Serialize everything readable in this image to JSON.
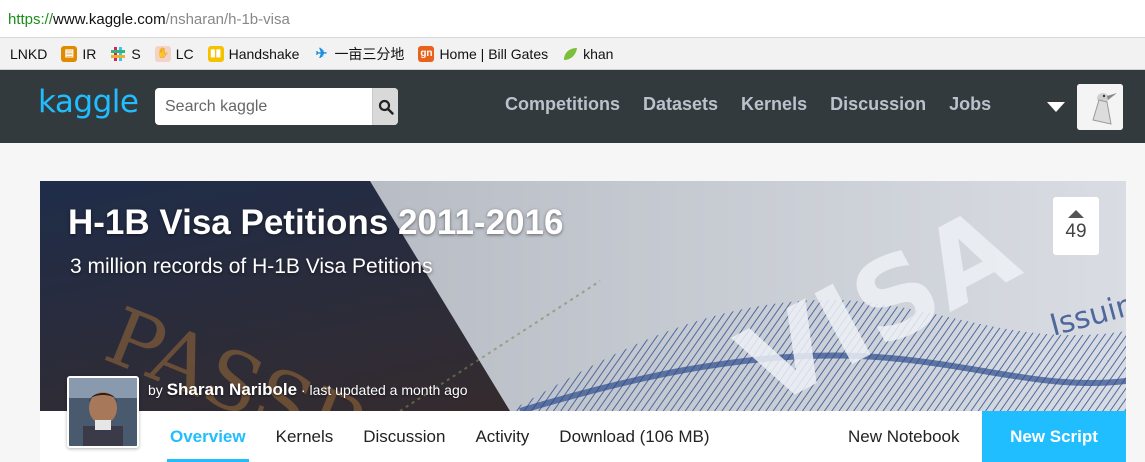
{
  "browser": {
    "url_scheme": "https://",
    "url_host": "www.kaggle.com",
    "url_path": "/nsharan/h-1b-visa",
    "bookmarks": [
      {
        "label": "LNKD",
        "icon": "none"
      },
      {
        "label": "IR",
        "icon": "building-icon"
      },
      {
        "label": "S",
        "icon": "slack-icon"
      },
      {
        "label": "LC",
        "icon": "hand-icon"
      },
      {
        "label": "Handshake",
        "icon": "handshake-icon"
      },
      {
        "label": "一亩三分地",
        "icon": "bird-icon"
      },
      {
        "label": "Home | Bill Gates",
        "icon": "gn-icon"
      },
      {
        "label": "khan",
        "icon": "leaf-icon"
      }
    ]
  },
  "header": {
    "logo": "kaggle",
    "search_placeholder": "Search kaggle",
    "nav": [
      "Competitions",
      "Datasets",
      "Kernels",
      "Discussion",
      "Jobs"
    ]
  },
  "dataset": {
    "title": "H-1B Visa Petitions 2011-2016",
    "subtitle": "3 million records of H-1B Visa Petitions",
    "by": "by",
    "author": "Sharan Naribole",
    "updated": "· last updated a month ago",
    "votes": "49"
  },
  "tabs": {
    "items": [
      "Overview",
      "Kernels",
      "Discussion",
      "Activity",
      "Download (106 MB)"
    ],
    "active": "Overview",
    "new_notebook": "New Notebook",
    "new_script": "New Script"
  },
  "colors": {
    "accent": "#20beff",
    "header_bg": "#333a3e"
  }
}
